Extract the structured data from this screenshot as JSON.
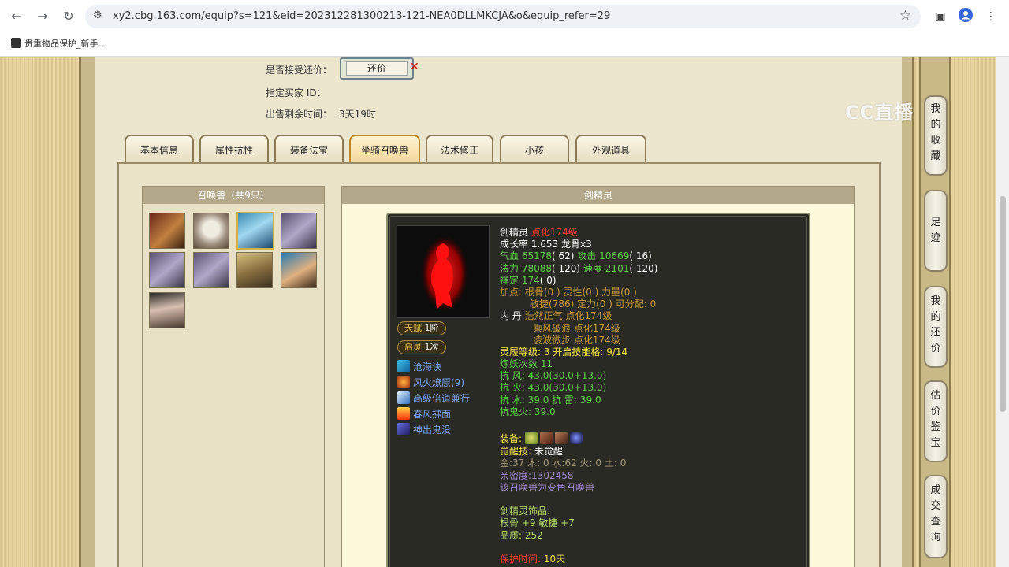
{
  "browser": {
    "url": "xy2.cbg.163.com/equip?s=121&eid=202312281300213-121-NEA0DLLMKCJA&o&equip_refer=29",
    "bookmark": "贵重物品保护_新手..."
  },
  "watermark": "CC直播",
  "sale_info": {
    "accept_counter_label": "是否接受还价：",
    "counter_button": "还价",
    "buyer_id_label": "指定买家 ID：",
    "time_left_label": "出售剩余时间：",
    "time_left_value": "3天19时"
  },
  "tabs": [
    "基本信息",
    "属性抗性",
    "装备法宝",
    "坐骑召唤兽",
    "法术修正",
    "小孩",
    "外观道具"
  ],
  "active_tab": "坐骑召唤兽",
  "pet_list": {
    "title": "召唤兽（共9只）",
    "count": 9
  },
  "detail": {
    "title": "剑精灵",
    "talent_label": "天赋",
    "talent_value": "1阶",
    "spirit_label": "启灵",
    "spirit_value": "1次",
    "skills": [
      "沧海诀",
      "风火燎原(9)",
      "高级倍道兼行",
      "春风拂面",
      "神出鬼没"
    ],
    "stats": {
      "name": "剑精灵",
      "level": "点化174级",
      "growth": "成长率 1.653 龙骨x3",
      "hp_label": "气血",
      "hp": "65178",
      "hp_pt": "( 62)",
      "atk_label": "攻击",
      "atk": "10669",
      "atk_pt": "( 16)",
      "mp_label": "法力",
      "mp": "78088",
      "mp_pt": "( 120)",
      "spd_label": "速度",
      "spd": "2101",
      "spd_pt": "( 120)",
      "zen_label": "禅定",
      "zen": "174",
      "zen_pt": "( 0)",
      "points_1": "加点:  根骨(0 ) 灵性(0 ) 力量(0 )",
      "points_2": "敏捷(786) 定力(0 ) 可分配:  0",
      "dan_label": "内  丹",
      "dan_1": "浩然正气 点化174级",
      "dan_2": "乘风破浪 点化174级",
      "dan_3": "凌波微步 点化174级",
      "spirit_level_label": "灵履等级:",
      "spirit_level": "3",
      "spirit_grid_label": "开启技能格:",
      "spirit_grid": "9/14",
      "refine_label": "炼妖次数",
      "refine": "11",
      "res_wind": "抗   风: 43.0(30.0+13.0)",
      "res_fire": "抗   火: 43.0(30.0+13.0)",
      "res_water": "抗   水: 39.0 抗   雷: 39.0",
      "res_ghost": "抗鬼火: 39.0",
      "equip_label": "装备:",
      "awaken_label": "觉醒技:",
      "awaken_value": "未觉醒",
      "elements": "金:37 木: 0 水:62 火: 0 土: 0",
      "intimacy": "亲密度:1302458",
      "variant": "该召唤兽为变色召唤兽",
      "ornament_title": "剑精灵饰品:",
      "ornament_attr": "根骨 +9 敏捷 +7",
      "ornament_quality": "品质:  252",
      "protect_label": "保护时间:",
      "protect_value": "10天"
    }
  },
  "sidebar": [
    "我的收藏",
    "足迹",
    "我的还价",
    "估价鉴宝",
    "成交查询"
  ]
}
